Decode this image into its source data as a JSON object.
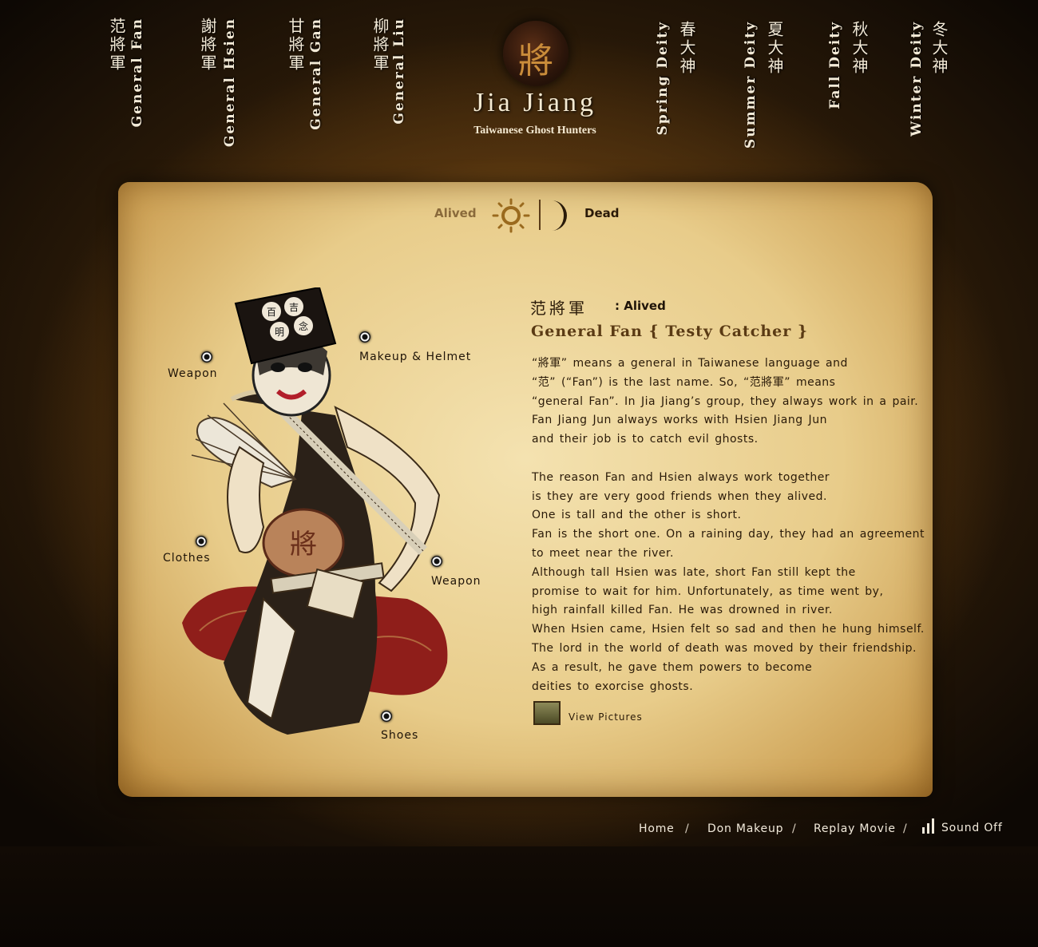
{
  "nav_left": [
    {
      "cn": "范將軍",
      "en": "General Fan"
    },
    {
      "cn": "謝將軍",
      "en": "General Hsien"
    },
    {
      "cn": "甘將軍",
      "en": "General Gan"
    },
    {
      "cn": "柳將軍",
      "en": "General Liu"
    }
  ],
  "nav_right": [
    {
      "cn": "春大神",
      "en": "Spring Deity"
    },
    {
      "cn": "夏大神",
      "en": "Summer Deity"
    },
    {
      "cn": "秋大神",
      "en": "Fall Deity"
    },
    {
      "cn": "冬大神",
      "en": "Winter Deity"
    }
  ],
  "logo": {
    "glyph": "將",
    "title": "Jia Jiang",
    "subtitle": "Taiwanese Ghost Hunters"
  },
  "toggle": {
    "alived": "Alived",
    "dead": "Dead"
  },
  "hotspots": {
    "weapon_left": "Weapon",
    "makeup": "Makeup & Helmet",
    "clothes": "Clothes",
    "weapon_right": "Weapon",
    "shoes": "Shoes"
  },
  "character": {
    "name_cn": "范將軍",
    "state": ": Alived",
    "name_en": "General Fan { Testy Catcher }",
    "description": [
      "“將軍” means a general in Taiwanese language and",
      "“范” (“Fan”) is the last name. So, “范將軍” means",
      "“general Fan”. In Jia Jiang’s group, they always work in a pair.",
      "Fan Jiang Jun always works with Hsien Jiang Jun",
      "and their job is to catch evil ghosts.",
      "",
      "The reason Fan and Hsien always work together",
      "is they are very good friends when they alived.",
      "One is tall and the other is short.",
      "Fan is the short one. On a raining day, they had an agreement",
      "to meet near the river.",
      "Although tall Hsien was late, short Fan still kept the",
      "promise to wait for him. Unfortunately, as time went by,",
      "high rainfall killed Fan. He was drowned in river.",
      "When Hsien came, Hsien felt so sad and then he hung himself.",
      "The lord in the world of death was moved by their friendship.",
      "As a result, he gave them powers to become",
      "deities to exorcise ghosts."
    ],
    "view_pictures": "View Pictures"
  },
  "footer": {
    "home": "Home",
    "don_makeup": "Don Makeup",
    "replay_movie": "Replay Movie",
    "sound": "Sound Off",
    "separator": "/"
  },
  "colors": {
    "parchment": "#e8cc8a",
    "text_dark": "#2a1a08",
    "nav_text": "#f3ead7",
    "seal": "#2b150a"
  }
}
